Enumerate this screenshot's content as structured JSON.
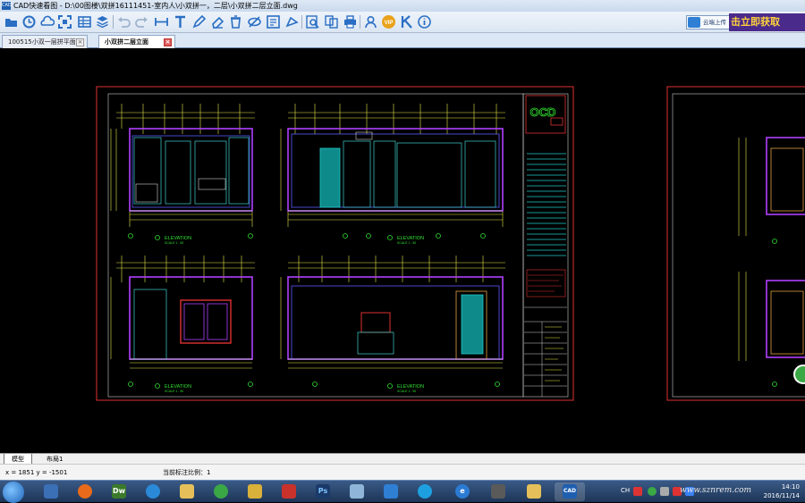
{
  "window": {
    "title": "CAD快速看图 - D:\\00图楼\\双拼16111451-室内人\\小双拼一，二层\\小双拼二层立面.dwg",
    "app_icon_text": "CAD"
  },
  "toolbar": {
    "icons": [
      "open-folder-icon",
      "recent-clock-icon",
      "cloud-icon",
      "fit-view-icon",
      "table-icon",
      "layers-icon",
      "undo-icon",
      "redo-icon",
      "measure-icon",
      "text-icon",
      "pen-icon",
      "eraser-icon",
      "delete-icon",
      "hide-icon",
      "count-icon",
      "area-icon",
      "find-icon",
      "compare-icon",
      "print-icon",
      "user-icon",
      "vip-icon",
      "k-icon",
      "info-icon"
    ],
    "upload_label": "云端上传",
    "promo_text": "击立即获取",
    "colors": {
      "icon": "#2a6fc4",
      "promo_bg": "#4a2a8a",
      "promo_text": "#ffd23c"
    }
  },
  "tabs": [
    {
      "label": "100515小双一层拼平面",
      "active": false
    },
    {
      "label": "小双拼二层立面",
      "active": true
    }
  ],
  "drawing": {
    "elevation_label": "ELEVATION",
    "scale_label": "SCALE 1 : 50",
    "logo_text": "OCD",
    "colors": {
      "frame": "#e03030",
      "wall": "#b040ff",
      "dim": "#e8e84a",
      "cyan": "#20c8c8",
      "green": "#30e030"
    }
  },
  "layout_tabs": [
    {
      "label": "模型",
      "active": true
    },
    {
      "label": "布局1",
      "active": false
    }
  ],
  "status": {
    "coords": "x = 1851  y = -1501",
    "scale": "当前标注比例：1"
  },
  "taskbar": {
    "apps": [
      "windows-explorer",
      "firefox",
      "dreamweaver",
      "qq-browser",
      "explorer-folder",
      "green-app",
      "wenjian",
      "wps",
      "photoshop",
      "notepad",
      "baidu-cloud",
      "tencent-cloud",
      "ie",
      "eye-app",
      "folder-blue",
      "cad-viewer"
    ],
    "input_method": "CH",
    "time": "14:10",
    "date": "2016/11/14",
    "watermark": "www.sznrem.com"
  }
}
